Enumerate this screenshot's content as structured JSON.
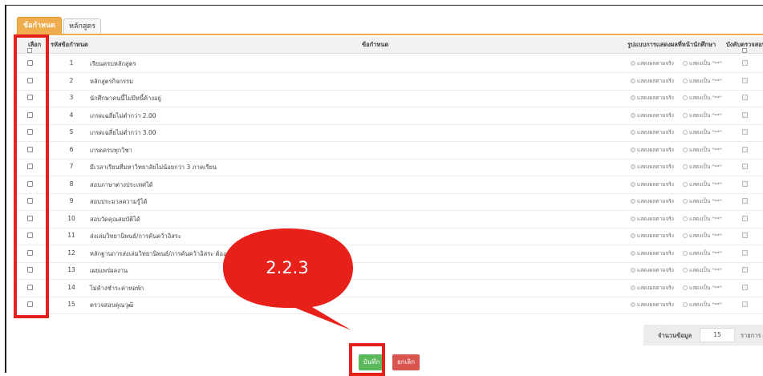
{
  "tabs": [
    {
      "label": "ข้อกำหนด",
      "active": true
    },
    {
      "label": "หลักสูตร",
      "active": false
    }
  ],
  "table": {
    "headers": {
      "select": "เลือก",
      "code": "รหัสข้อกำหนด",
      "requirement": "ข้อกำหนด",
      "display_format": "รูปแบบการแสดงผลที่หน้านักศึกษา",
      "mandatory_check": "บังคับตรวจสอบ"
    },
    "option_labels": {
      "actual": "แสดงผลตามจริง",
      "as_stars": "แสดงเป็น \"**\""
    },
    "rows": [
      {
        "num": "1",
        "name": "เรียนครบหลักสูตร"
      },
      {
        "num": "2",
        "name": "หลักสูตรกิจกรรม"
      },
      {
        "num": "3",
        "name": "นักศึกษาคนนี้ไม่มีหนี้ค้างอยู่"
      },
      {
        "num": "4",
        "name": "เกรดเฉลี่ยไม่ต่ำกว่า 2.00"
      },
      {
        "num": "5",
        "name": "เกรดเฉลี่ยไม่ต่ำกว่า 3.00"
      },
      {
        "num": "6",
        "name": "เกรดครบทุกวิชา"
      },
      {
        "num": "7",
        "name": "มีเวลาเรียนที่มหาวิทยาลัยไม่น้อยกว่า 3 ภาคเรียน"
      },
      {
        "num": "8",
        "name": "สอบภาษาต่างประเทศได้"
      },
      {
        "num": "9",
        "name": "สอบประมวลความรู้ได้"
      },
      {
        "num": "10",
        "name": "สอบวัดคุณสมบัติได้"
      },
      {
        "num": "11",
        "name": "ส่งเล่มวิทยานิพนธ์/การค้นคว้าอิสระ"
      },
      {
        "num": "12",
        "name": "หลักฐานการส่งเล่มวิทยานิพนธ์/การค้นคว้าอิสระ ต้องส"
      },
      {
        "num": "13",
        "name": "เผยแพร่ผลงาน"
      },
      {
        "num": "14",
        "name": "ไม่ค้างชำระค่าหอพัก"
      },
      {
        "num": "15",
        "name": "ตรวจสอบคุณวุฒิ"
      }
    ]
  },
  "footer": {
    "count_label": "จำนวนข้อมูล",
    "count_value": "15",
    "unit": "รายการ"
  },
  "buttons": {
    "save": "บันทึก",
    "cancel": "ยกเลิก"
  },
  "annotation": {
    "callout_text": "2.2.3"
  },
  "colors": {
    "accent": "#f0ad4e",
    "save": "#5cb85c",
    "cancel": "#d9534f",
    "annotation": "#e8201a"
  }
}
